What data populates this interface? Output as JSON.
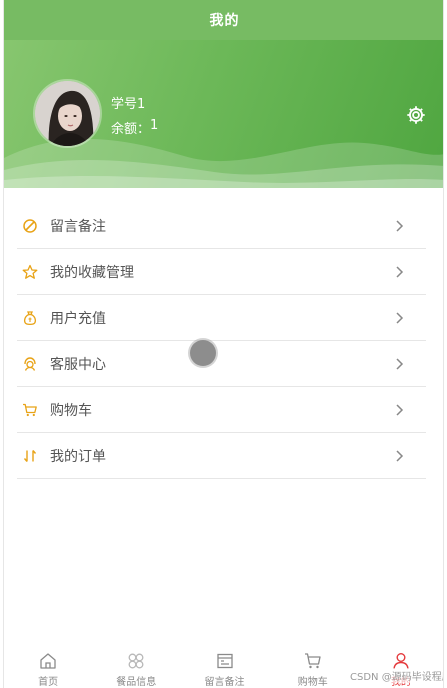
{
  "header": {
    "title": "我的"
  },
  "profile": {
    "name": "学号1",
    "balance_label": "余额：",
    "balance_value": "1"
  },
  "menu": [
    {
      "label": "留言备注",
      "icon": "edit-icon"
    },
    {
      "label": "我的收藏管理",
      "icon": "star-icon"
    },
    {
      "label": "用户充值",
      "icon": "money-bag-icon"
    },
    {
      "label": "客服中心",
      "icon": "customer-service-icon"
    },
    {
      "label": "购物车",
      "icon": "cart-icon"
    },
    {
      "label": "我的订单",
      "icon": "order-sort-icon"
    }
  ],
  "tabbar": [
    {
      "label": "首页",
      "icon": "home-icon"
    },
    {
      "label": "餐品信息",
      "icon": "clover-icon"
    },
    {
      "label": "留言备注",
      "icon": "message-board-icon"
    },
    {
      "label": "购物车",
      "icon": "cart-icon"
    },
    {
      "label": "我的",
      "icon": "user-icon",
      "active": true
    }
  ],
  "watermark": "CSDN @源码毕设程序",
  "colors": {
    "brand_green": "#77bb63",
    "menu_icon": "#e8a317",
    "active_tab": "#e4393c"
  }
}
